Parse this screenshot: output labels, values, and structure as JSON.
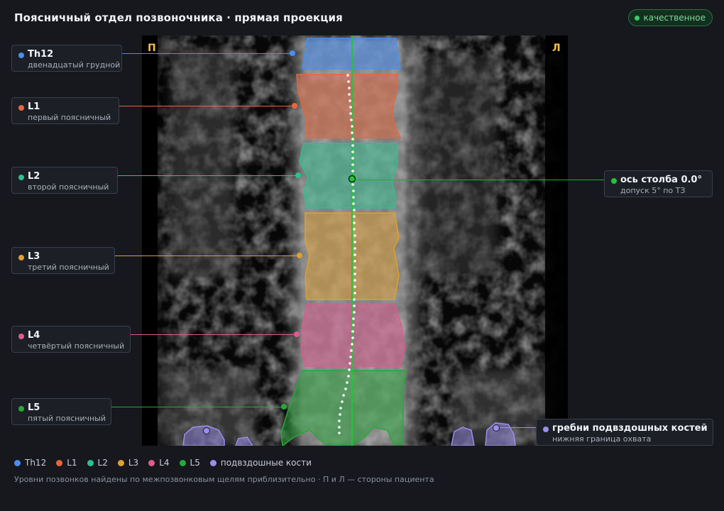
{
  "title": "Поясничный отдел позвоночника · прямая проекция",
  "badge": {
    "label": "качественное",
    "color": "#3fca6a"
  },
  "orientation": {
    "right_marker": "П",
    "left_marker": "Л"
  },
  "vertebrae": [
    {
      "id": "Th12",
      "name": "Th12",
      "description": "двенадцатый грудной",
      "color": "#4a8ff0"
    },
    {
      "id": "L1",
      "name": "L1",
      "description": "первый поясничный",
      "color": "#e8663a"
    },
    {
      "id": "L2",
      "name": "L2",
      "description": "второй поясничный",
      "color": "#2fbf8f"
    },
    {
      "id": "L3",
      "name": "L3",
      "description": "третий поясничный",
      "color": "#e0a030"
    },
    {
      "id": "L4",
      "name": "L4",
      "description": "четвёртый поясничный",
      "color": "#e05a8e"
    },
    {
      "id": "L5",
      "name": "L5",
      "description": "пятый поясничный",
      "color": "#27a83a"
    }
  ],
  "axis": {
    "name": "ось столба 0.0°",
    "description": "допуск 5° по ТЗ",
    "color": "#27c23a"
  },
  "iliac": {
    "name": "гребни подвздошных костей",
    "description": "нижняя граница охвата",
    "color": "#9b8ef0"
  },
  "legend": [
    {
      "label": "Th12",
      "color": "#4a8ff0"
    },
    {
      "label": "L1",
      "color": "#e8663a"
    },
    {
      "label": "L2",
      "color": "#2fbf8f"
    },
    {
      "label": "L3",
      "color": "#e0a030"
    },
    {
      "label": "L4",
      "color": "#e05a8e"
    },
    {
      "label": "L5",
      "color": "#27a83a"
    },
    {
      "label": "подвздошные кости",
      "color": "#9b8ef0"
    }
  ],
  "footnote": "Уровни позвонков найдены по межпозвонковым щелям приблизительно · П и Л — стороны пациента"
}
